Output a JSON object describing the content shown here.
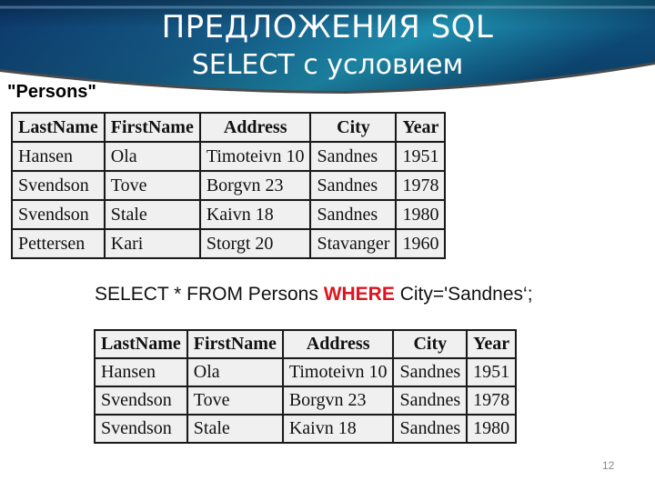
{
  "slide": {
    "title_line1": "ПРЕДЛОЖЕНИЯ SQL",
    "title_line2": "SELECT с условием",
    "table_caption": "\"Persons\"",
    "page_number": "12",
    "colors": {
      "banner_dark": "#0b3a6b",
      "banner_light": "#1e8fb0",
      "keyword": "#e0141e"
    }
  },
  "persons_table": {
    "columns": [
      "LastName",
      "FirstName",
      "Address",
      "City",
      "Year"
    ],
    "rows": [
      [
        "Hansen",
        "Ola",
        "Timoteivn 10",
        "Sandnes",
        "1951"
      ],
      [
        "Svendson",
        "Tove",
        "Borgvn 23",
        "Sandnes",
        "1978"
      ],
      [
        "Svendson",
        "Stale",
        "Kaivn 18",
        "Sandnes",
        "1980"
      ],
      [
        "Pettersen",
        "Kari",
        "Storgt 20",
        "Stavanger",
        "1960"
      ]
    ]
  },
  "query": {
    "before": "SELECT * FROM Persons ",
    "keyword": "WHERE",
    "after": " City='Sandnes‘;"
  },
  "result_table": {
    "columns": [
      "LastName",
      "FirstName",
      "Address",
      "City",
      "Year"
    ],
    "rows": [
      [
        "Hansen",
        "Ola",
        "Timoteivn 10",
        "Sandnes",
        "1951"
      ],
      [
        "Svendson",
        "Tove",
        "Borgvn 23",
        "Sandnes",
        "1978"
      ],
      [
        "Svendson",
        "Stale",
        "Kaivn 18",
        "Sandnes",
        "1980"
      ]
    ]
  }
}
